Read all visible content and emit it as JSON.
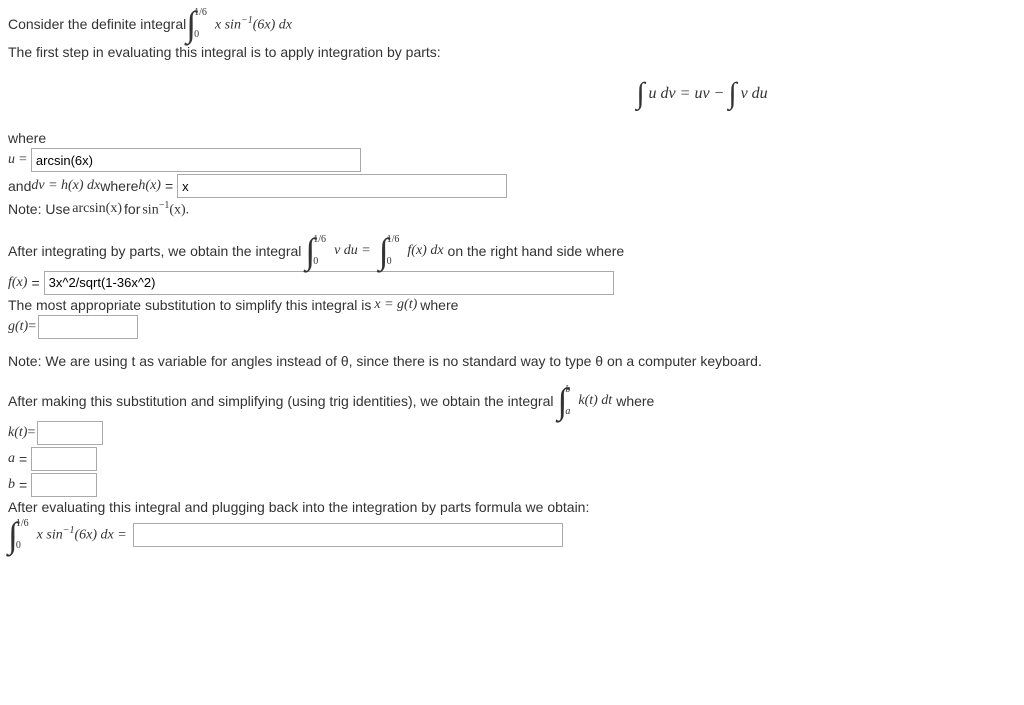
{
  "intro_prefix": "Consider the definite integral ",
  "main_integral": {
    "upper": "1/6",
    "lower": "0",
    "body": "x sin",
    "exp": "−1",
    "tail": "(6x) dx"
  },
  "intro_step": "The first step in evaluating this integral is to apply integration by parts:",
  "ibp_formula": {
    "lhs": "u dv = uv − ",
    "rhs": "v du"
  },
  "where_label": "where",
  "u_label": "u",
  "eq": "=",
  "u_value": "arcsin(6x)",
  "dv_prefix": "and ",
  "dv_mid1": "dv = h(x) dx",
  "dv_mid2": " where ",
  "hx_label": "h(x)",
  "hx_value": "x",
  "note_arcsin_pre": "Note: Use ",
  "note_arcsin_fn": "arcsin(x)",
  "note_arcsin_mid": " for ",
  "note_arcsin_sin": "sin",
  "note_arcsin_exp": "−1",
  "note_arcsin_tail": "(x).",
  "after_ibp_pre": "After integrating by parts, we obtain the integral ",
  "vdu_int": {
    "upper": "1/6",
    "lower": "0",
    "body": "v du = "
  },
  "fx_int": {
    "upper": "1/6",
    "lower": "0",
    "body": "f(x) dx"
  },
  "after_ibp_post": " on the right hand side where",
  "fx_label": "f(x)",
  "fx_value": "3x^2/sqrt(1-36x^2)",
  "sub_line_pre": "The most appropriate substitution to simplify this integral is ",
  "sub_eq": "x = g(t)",
  "sub_line_post": " where",
  "gt_label": "g(t)",
  "note_t": "Note: We are using t as variable for angles instead of θ, since there is no standard way to type θ on a computer keyboard.",
  "after_sub_pre": "After making this substitution and simplifying (using trig identities), we obtain the integral ",
  "kt_int": {
    "upper": "b",
    "lower": "a",
    "body": "k(t) dt"
  },
  "after_sub_post": " where",
  "kt_label": "k(t)",
  "a_label": "a",
  "b_label": "b",
  "final_line": "After evaluating this integral and plugging back into the integration by parts formula we obtain:",
  "final_integral": {
    "upper": "1/6",
    "lower": "0",
    "body": "x sin",
    "exp": "−1",
    "tail": "(6x) dx ="
  }
}
